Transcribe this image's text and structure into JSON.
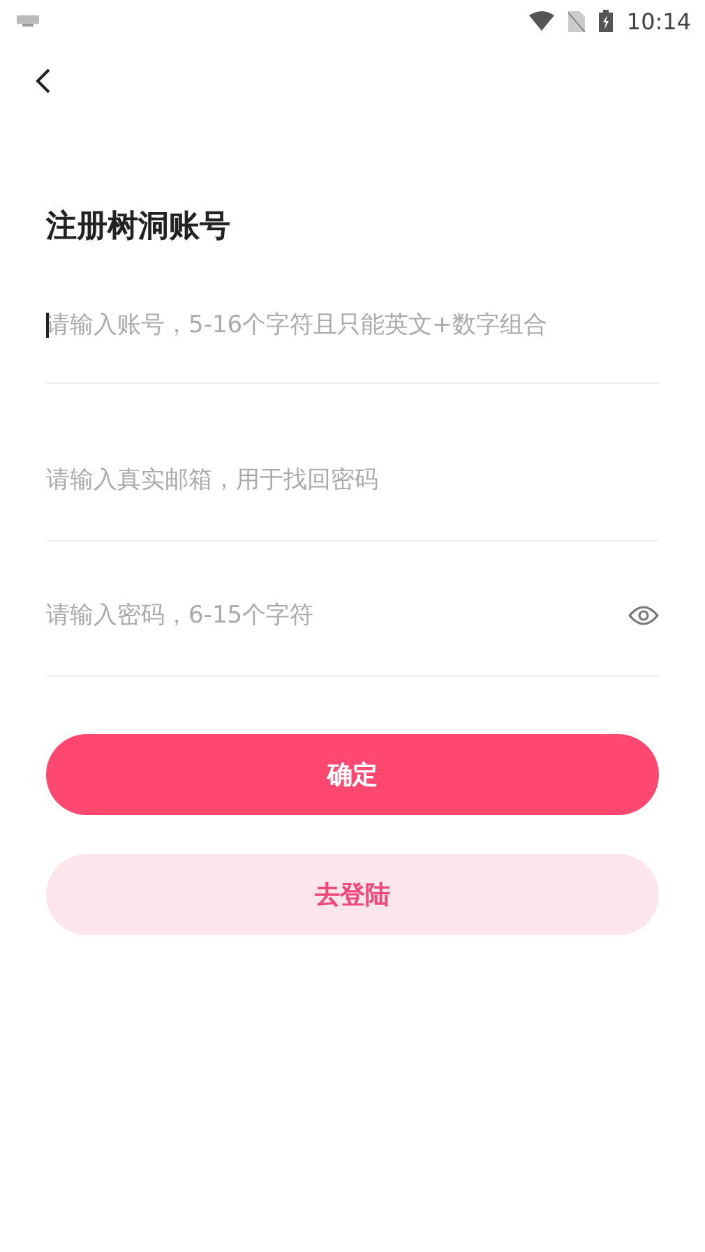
{
  "status_bar": {
    "time": "10:14"
  },
  "title": "注册树洞账号",
  "fields": [
    {
      "kind": "text",
      "placeholder": "请输入账号，5-16个字符且只能英文+数字组合",
      "focused": true
    },
    {
      "kind": "text",
      "placeholder": "请输入真实邮箱，用于找回密码",
      "focused": false
    },
    {
      "kind": "password",
      "placeholder": "请输入密码，6-15个字符",
      "focused": false
    }
  ],
  "buttons": [
    {
      "kind": "primary",
      "label": "确定"
    },
    {
      "kind": "secondary",
      "label": "去登陆"
    }
  ]
}
